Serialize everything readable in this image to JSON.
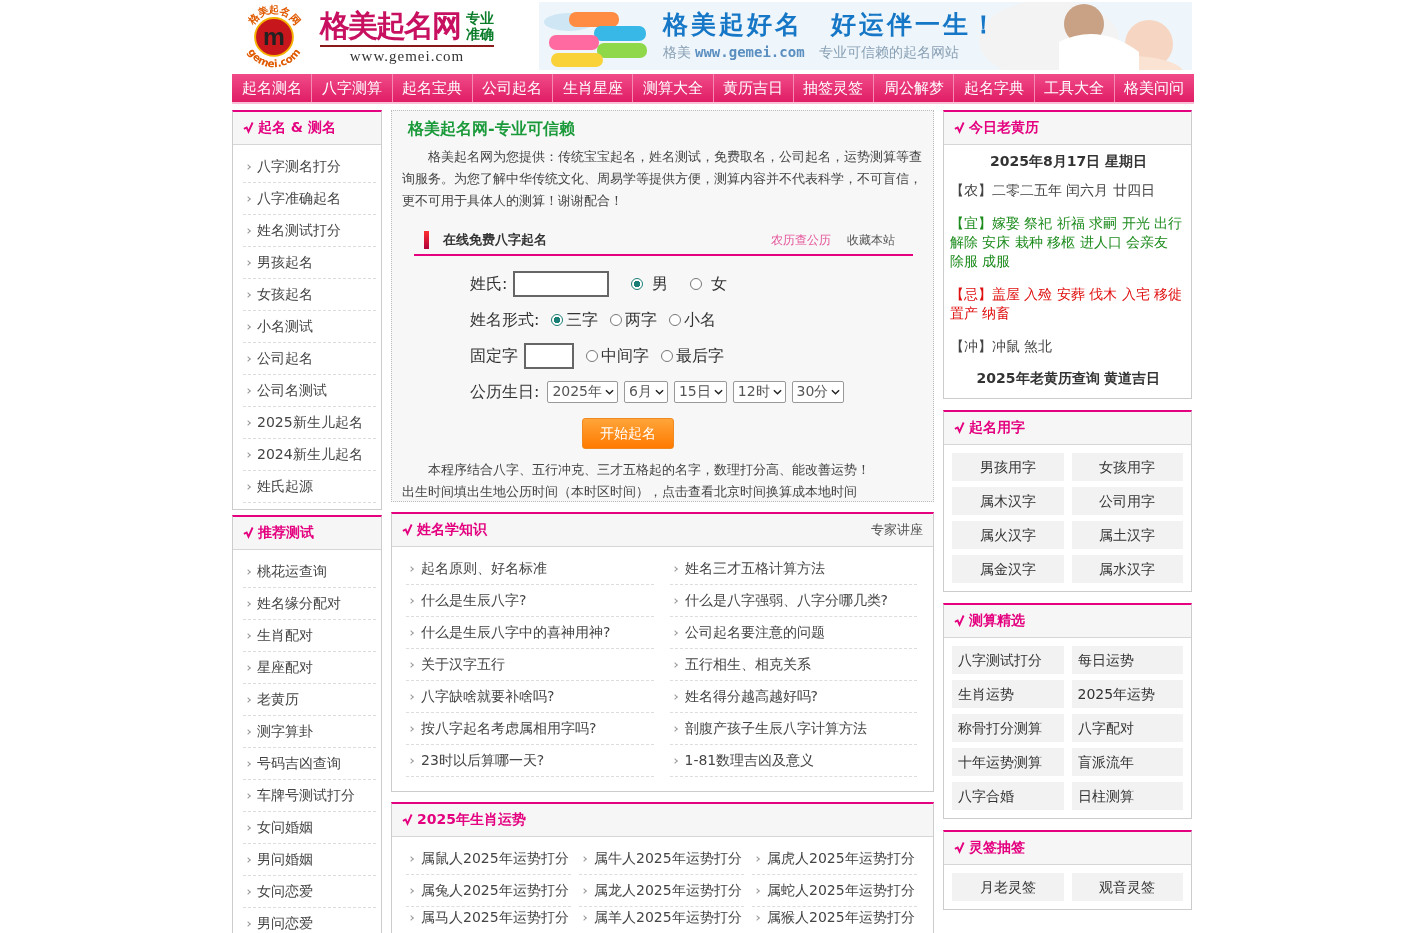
{
  "header": {
    "logo": {
      "ring_top": "格美起名网",
      "ring_bottom": "gemei.com",
      "mark": "m",
      "name": "格美起名网",
      "tag_1": "专业",
      "tag_2": "准确",
      "url": "www.gemei.com"
    },
    "banner": {
      "title": "格美起好名　好运伴一生！",
      "prefix": "格美",
      "url": "www.gemei.com",
      "tagline": "专业可信赖的起名网站"
    }
  },
  "nav": [
    "起名测名",
    "八字测算",
    "起名宝典",
    "公司起名",
    "生肖星座",
    "测算大全",
    "黄历吉日",
    "抽签灵签",
    "周公解梦",
    "起名字典",
    "工具大全",
    "格美问问"
  ],
  "left_sections": [
    {
      "title": "起名 & 测名",
      "items": [
        "八字测名打分",
        "八字准确起名",
        "姓名测试打分",
        "男孩起名",
        "女孩起名",
        "小名测试",
        "公司起名",
        "公司名测试",
        "2025新生儿起名",
        "2024新生儿起名",
        "姓氏起源"
      ]
    },
    {
      "title": "推荐测试",
      "items": [
        "桃花运查询",
        "姓名缘分配对",
        "生肖配对",
        "星座配对",
        "老黄历",
        "测字算卦",
        "号码吉凶查询",
        "车牌号测试打分",
        "女问婚姻",
        "男问婚姻",
        "女问恋爱",
        "男问恋爱"
      ]
    }
  ],
  "intro": {
    "title": "格美起名网-专业可信赖",
    "text": "格美起名网为您提供：传统宝宝起名，姓名测试，免费取名，公司起名，运势测算等查询服务。为您了解中华传统文化、周易学等提供方便，测算内容并不代表科学，不可盲信，更不可用于具体人的测算！谢谢配合！"
  },
  "form": {
    "title": "在线免费八字起名",
    "links": [
      {
        "label": "农历查公历",
        "highlight": true
      },
      {
        "label": "收藏本站",
        "highlight": false
      }
    ],
    "rows": [
      {
        "kind": "textbox",
        "label": "姓氏:",
        "options": [
          {
            "label": "男",
            "selected": true
          },
          {
            "label": "女",
            "selected": false
          }
        ]
      },
      {
        "kind": "radio",
        "label": "姓名形式:",
        "options": [
          {
            "label": "三字",
            "selected": true
          },
          {
            "label": "两字",
            "selected": false
          },
          {
            "label": "小名",
            "selected": false
          }
        ]
      },
      {
        "kind": "charbox",
        "label": "固定字",
        "options": [
          {
            "label": "中间字",
            "selected": false
          },
          {
            "label": "最后字",
            "selected": false
          }
        ]
      },
      {
        "kind": "select",
        "label": "公历生日:",
        "selects": [
          "2025年",
          "6月",
          "15日",
          "12时",
          "30分"
        ]
      }
    ],
    "button": "开始起名",
    "notes": [
      "本程序结合八字、五行冲克、三才五格起的名字，数理打分高、能改善运势！",
      "出生时间填出生地公历时间（本时区时间），点击查看北京时间换算成本地时间"
    ]
  },
  "knowledge": {
    "title": "姓名学知识",
    "link": "专家讲座",
    "items": [
      "起名原则、好名标准",
      "姓名三才五格计算方法",
      "什么是生辰八字?",
      "什么是八字强弱、八字分哪几类?",
      "什么是生辰八字中的喜神用神?",
      "公司起名要注意的问题",
      "关于汉字五行",
      "五行相生、相克关系",
      "八字缺啥就要补啥吗?",
      "姓名得分越高越好吗?",
      "按八字起名考虑属相用字吗?",
      "剖腹产孩子生辰八字计算方法",
      "23时以后算哪一天?",
      "1-81数理吉凶及意义"
    ]
  },
  "zodiac": {
    "title": "2025年生肖运势",
    "items": [
      "属鼠人2025年运势打分",
      "属牛人2025年运势打分",
      "属虎人2025年运势打分",
      "属兔人2025年运势打分",
      "属龙人2025年运势打分",
      "属蛇人2025年运势打分",
      "属马人2025年运势打分",
      "属羊人2025年运势打分",
      "属猴人2025年运势打分"
    ]
  },
  "almanac": {
    "title": "今日老黄历",
    "date": "2025年8月17日 星期日",
    "rows": [
      {
        "lines": [
          "【农】二零二五年 闰六月 廿四日"
        ],
        "color": "#444444"
      },
      {
        "lines": [
          "【宜】嫁娶 祭祀 祈福 求嗣 开光 出行",
          "解除 安床 栽种 移柩 进人口 会亲友",
          "除服 成服"
        ],
        "color": "#1e8c1e"
      },
      {
        "lines": [
          "【忌】盖屋 入殓 安葬 伐木 入宅 移徙",
          "置产 纳畜"
        ],
        "color": "#e01010"
      },
      {
        "lines": [
          "【冲】冲鼠 煞北"
        ],
        "color": "#444444"
      }
    ],
    "footer": "2025年老黄历查询 黄道吉日"
  },
  "right_sections": [
    {
      "title": "起名用字",
      "kind": "centered",
      "items": [
        "男孩用字",
        "女孩用字",
        "属木汉字",
        "公司用字",
        "属火汉字",
        "属土汉字",
        "属金汉字",
        "属水汉字"
      ]
    },
    {
      "title": "测算精选",
      "kind": "left",
      "items": [
        "八字测试打分",
        "每日运势",
        "生肖运势",
        "2025年运势",
        "称骨打分测算",
        "八字配对",
        "十年运势测算",
        "盲派流年",
        "八字合婚",
        "日柱测算"
      ]
    },
    {
      "title": "灵签抽签",
      "kind": "centered",
      "items": [
        "月老灵签",
        "观音灵签"
      ]
    }
  ]
}
